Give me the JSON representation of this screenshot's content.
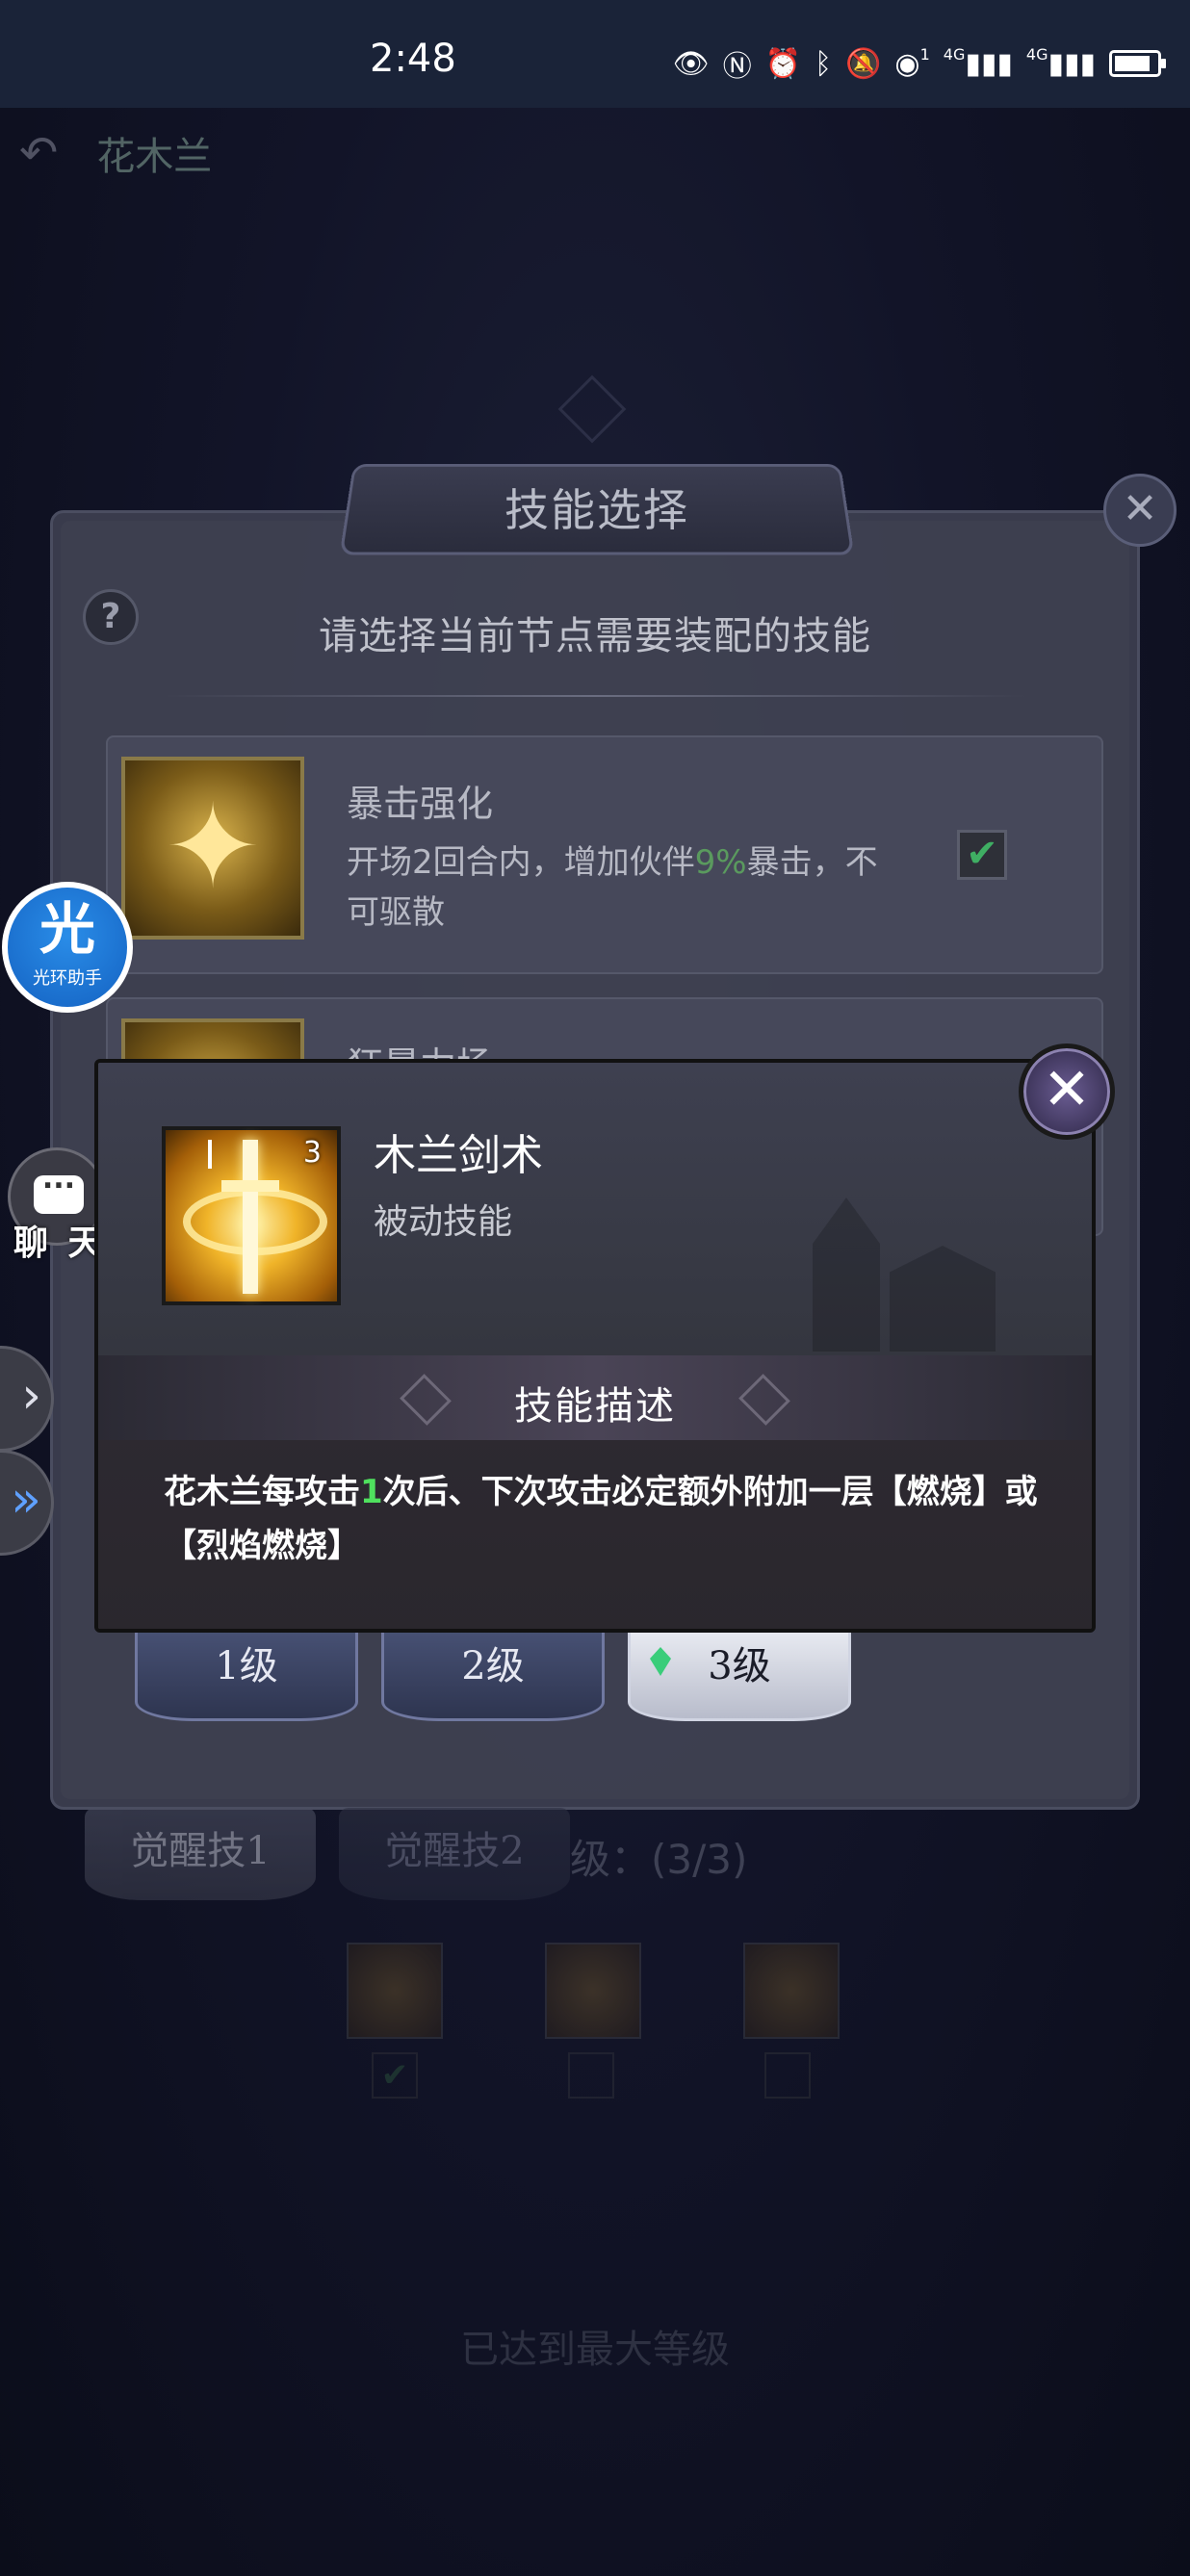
{
  "status_bar": {
    "time": "2:48",
    "signal_1_label": "1",
    "net_1": "4G",
    "net_2": "4G"
  },
  "background": {
    "back_icon": "back-arrow-icon",
    "hero_name": "花木兰",
    "awaken_tabs": [
      "觉醒技1",
      "觉醒技2"
    ],
    "level_progress_text": "级：(3/3)",
    "max_level_text": "已达到最大等级"
  },
  "skill_dialog": {
    "title": "技能选择",
    "prompt": "请选择当前节点需要装配的技能",
    "rows": [
      {
        "title": "暴击强化",
        "desc_before": "开场2回合内，增加伙伴",
        "desc_pct": "9%",
        "desc_after": "暴击，不可驱散",
        "checked": true
      },
      {
        "title": "狂暴力场"
      }
    ],
    "level_tabs": [
      "1级",
      "2级",
      "3级"
    ],
    "active_level": "3级"
  },
  "side_tools": {
    "assistant_big": "光",
    "assistant_small": "光环助手",
    "chat_label": "聊 天"
  },
  "popup": {
    "skill_name": "木兰剑术",
    "skill_type": "被动技能",
    "skill_level": "3",
    "section_title": "技能描述",
    "desc_part1": "花木兰每攻击",
    "desc_highlight": "1",
    "desc_part2": "次后、下次攻击必定额外附加一层【燃烧】或【烈焰燃烧】"
  },
  "colors": {
    "highlight_green": "#4fe05e",
    "assistant_blue": "#1f7ad6"
  }
}
